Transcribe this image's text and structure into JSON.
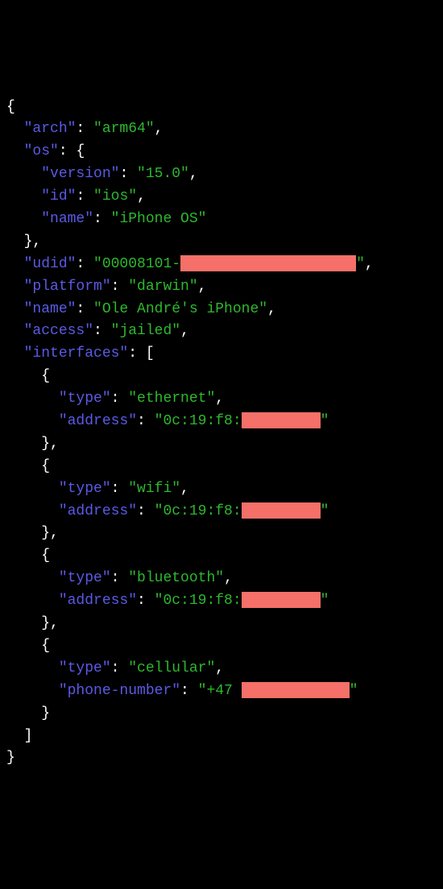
{
  "json": {
    "arch": "arm64",
    "os": {
      "version": "15.0",
      "id": "ios",
      "name": "iPhone OS"
    },
    "udid_prefix": "00008101-",
    "platform": "darwin",
    "name": "Ole André's iPhone",
    "access": "jailed",
    "interfaces": [
      {
        "type": "ethernet",
        "address_prefix": "0c:19:f8:"
      },
      {
        "type": "wifi",
        "address_prefix": "0c:19:f8:"
      },
      {
        "type": "bluetooth",
        "address_prefix": "0c:19:f8:"
      },
      {
        "type": "cellular",
        "phone_prefix": "+47 "
      }
    ]
  },
  "redact_widths": {
    "udid": 218,
    "mac": 98,
    "phone": 134
  }
}
